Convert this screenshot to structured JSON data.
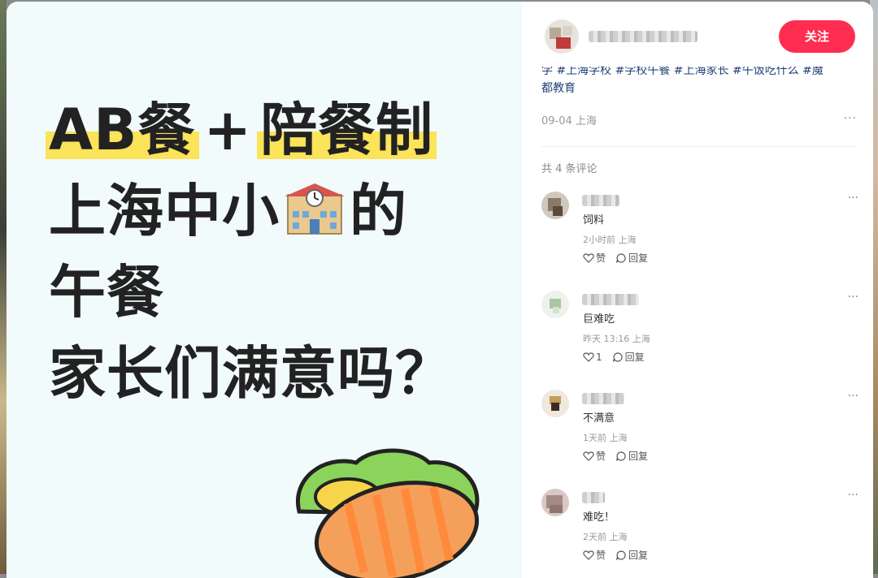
{
  "image": {
    "headline": {
      "part1": "AB餐",
      "plus": "+",
      "part2": "陪餐制",
      "line2_a": "上海中小",
      "line2_b": "的",
      "line3": "午餐",
      "line4": "家长们满意吗？"
    }
  },
  "author": {
    "follow_label": "关注"
  },
  "post": {
    "tags_line1": "学 #上海学校 #学校午餐 #上海家长 #午饭吃什么 #魔",
    "tags_line2": "都教育",
    "date_location": "09-04 上海",
    "more": "···"
  },
  "comments_header": "共 4 条评论",
  "comments": [
    {
      "text": "饲料",
      "meta": "2小时前 上海",
      "like": "赞",
      "reply": "回复"
    },
    {
      "text": "巨难吃",
      "meta": "昨天 13:16 上海",
      "like": "1",
      "reply": "回复"
    },
    {
      "text": "不满意",
      "meta": "1天前 上海",
      "like": "赞",
      "reply": "回复"
    },
    {
      "text": "难吃！",
      "meta": "2天前 上海",
      "like": "赞",
      "reply": "回复"
    }
  ],
  "colors": {
    "follow": "#ff2d4f",
    "tag": "#23417a",
    "highlight": "#fbe35a"
  }
}
